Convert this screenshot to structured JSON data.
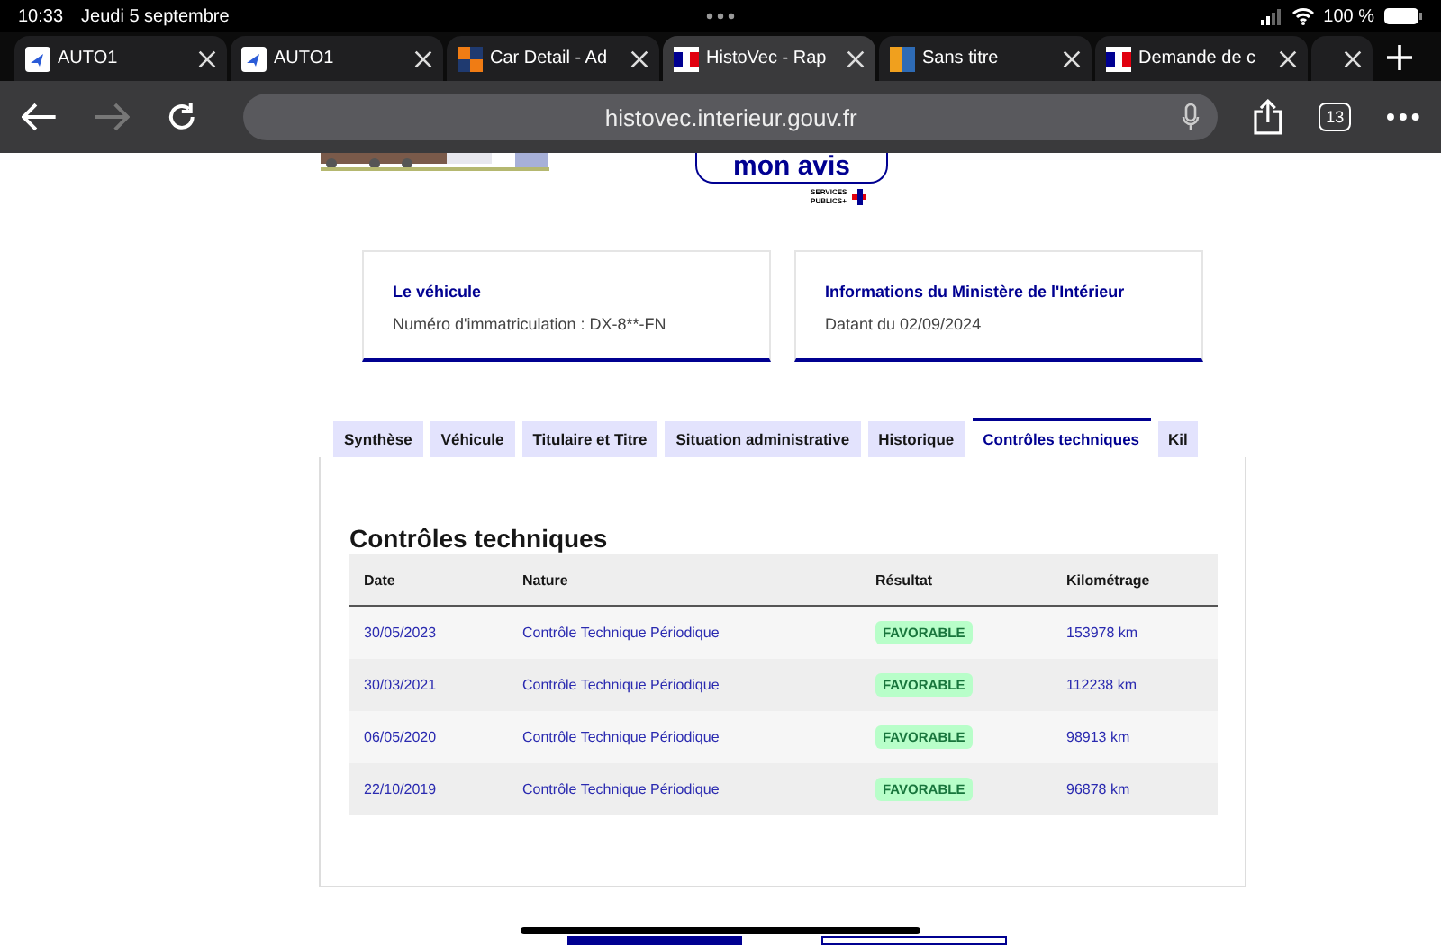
{
  "status_bar": {
    "time": "10:33",
    "date": "Jeudi 5 septembre",
    "battery": "100 %"
  },
  "browser_tabs": [
    {
      "title": "AUTO1",
      "kind": "arrow",
      "selected": false
    },
    {
      "title": "AUTO1",
      "kind": "arrow",
      "selected": false
    },
    {
      "title": "Car Detail - Ad",
      "kind": "squares",
      "selected": false
    },
    {
      "title": "HistoVec - Rap",
      "kind": "flag",
      "selected": true
    },
    {
      "title": "Sans titre",
      "kind": "bars",
      "selected": false
    },
    {
      "title": "Demande de c",
      "kind": "flag",
      "selected": false
    },
    {
      "kind": "blank",
      "selected": false
    }
  ],
  "toolbar": {
    "url": "histovec.interieur.gouv.fr",
    "tab_count": "13"
  },
  "header": {
    "feedback_button": "mon avis",
    "logo_text": "SERVICES PUBLICS+"
  },
  "cards": [
    {
      "title": "Le véhicule",
      "text": "Numéro d'immatriculation : DX-8**-FN"
    },
    {
      "title": "Informations du Ministère de l'Intérieur",
      "text": "Datant du 02/09/2024"
    }
  ],
  "tabs": [
    {
      "label": "Synthèse",
      "selected": false
    },
    {
      "label": "Véhicule",
      "selected": false
    },
    {
      "label": "Titulaire et Titre",
      "selected": false
    },
    {
      "label": "Situation administrative",
      "selected": false
    },
    {
      "label": "Historique",
      "selected": false
    },
    {
      "label": "Contrôles techniques",
      "selected": true
    },
    {
      "label": "Kil",
      "selected": false
    }
  ],
  "section_title": "Contrôles techniques",
  "table": {
    "columns": [
      "Date",
      "Nature",
      "Résultat",
      "Kilométrage"
    ],
    "rows": [
      {
        "date": "30/05/2023",
        "nature": "Contrôle Technique Périodique",
        "result": "FAVORABLE",
        "km": "153978 km"
      },
      {
        "date": "30/03/2021",
        "nature": "Contrôle Technique Périodique",
        "result": "FAVORABLE",
        "km": "112238 km"
      },
      {
        "date": "06/05/2020",
        "nature": "Contrôle Technique Périodique",
        "result": "FAVORABLE",
        "km": "98913 km"
      },
      {
        "date": "22/10/2019",
        "nature": "Contrôle Technique Périodique",
        "result": "FAVORABLE",
        "km": "96878 km"
      }
    ]
  }
}
